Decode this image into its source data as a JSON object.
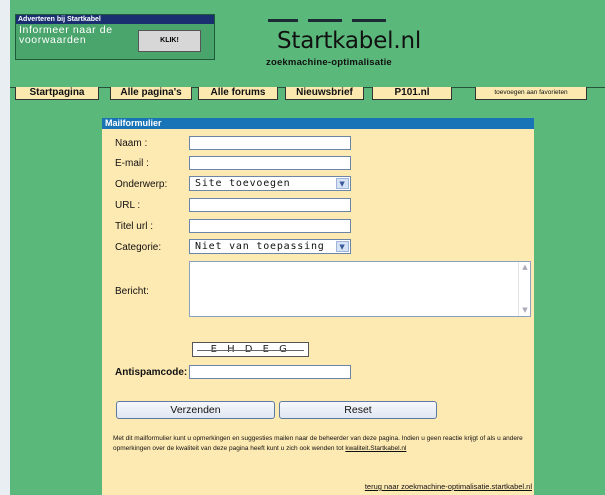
{
  "ad": {
    "title": "Adverteren bij Startkabel",
    "text": "Informeer naar de voorwaarden",
    "button": "KLIK!"
  },
  "logo": {
    "title": "Startkabel.nl",
    "subtitle": "zoekmachine-optimalisatie"
  },
  "tabs": [
    {
      "label": "Startpagina"
    },
    {
      "label": "Alle pagina's"
    },
    {
      "label": "Alle forums"
    },
    {
      "label": "Nieuwsbrief"
    },
    {
      "label": "P101.nl"
    },
    {
      "label": "toevoegen aan favorieten"
    }
  ],
  "form": {
    "header": "Mailformulier",
    "fields": {
      "naam": {
        "label": "Naam :",
        "value": ""
      },
      "email": {
        "label": "E-mail :",
        "value": ""
      },
      "onderwerp": {
        "label": "Onderwerp:",
        "value": "Site toevoegen"
      },
      "url": {
        "label": "URL :",
        "value": ""
      },
      "titel": {
        "label": "Titel url :",
        "value": ""
      },
      "categorie": {
        "label": "Categorie:",
        "value": "Niet van toepassing"
      },
      "bericht": {
        "label": "Bericht:",
        "value": ""
      }
    },
    "captcha": "E H D E G",
    "antispam_label": "Antispamcode:",
    "antispam_value": "",
    "submit": "Verzenden",
    "reset": "Reset",
    "info_text": "Met dit mailformulier kunt u opmerkingen en suggesties mailen naar de beheerder van deze pagina. Indien u geen reactie krijgt of als u andere opmerkingen over de kwaliteit van deze pagina heeft kunt u zich ook wenden tot ",
    "info_link": "kwaliteit.Startkabel.nl",
    "back_link": "terug naar zoekmachine-optimalisatie.startkabel.nl"
  }
}
